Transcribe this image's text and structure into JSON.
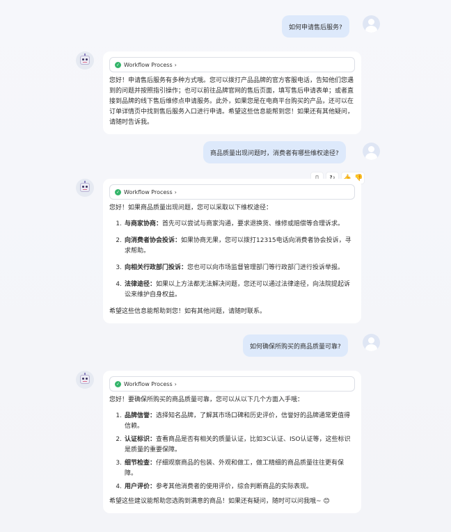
{
  "conversation": {
    "q1": "如何申请售后服务?",
    "a1": {
      "workflow": "Workflow Process",
      "text": "您好！申请售后服务有多种方式哦。您可以拨打产品品牌的官方客服电话，告知他们您遇到的问题并按照指引操作；也可以前往品牌官网的售后页面，填写售后申请表单；或者直接到品牌的线下售后维修点申请服务。此外，如果您是在电商平台购买的产品，还可以在订单详情页中找到售后服务入口进行申请。希望这些信息能帮到您！如果还有其他疑问，请随时告诉我。"
    },
    "q2": "商品质量出现问题时，消费者有哪些维权途径?",
    "a2": {
      "workflow": "Workflow Process",
      "intro": "您好！如果商品质量出现问题，您可以采取以下维权途径：",
      "items": [
        {
          "num": "1.",
          "title": "与商家协商：",
          "text": "首先可以尝试与商家沟通，要求退换货、维修或赔偿等合理诉求。"
        },
        {
          "num": "2.",
          "title": "向消费者协会投诉：",
          "text": "如果协商无果，您可以拨打12315电话向消费者协会投诉，寻求帮助。"
        },
        {
          "num": "3.",
          "title": "向相关行政部门投诉：",
          "text": "您也可以向市场监督管理部门等行政部门进行投诉举报。"
        },
        {
          "num": "4.",
          "title": "法律途径：",
          "text": "如果以上方法都无法解决问题，您还可以通过法律途径，向法院提起诉讼来维护自身权益。"
        }
      ],
      "outro": "希望这些信息能帮助到您！如有其他问题，请随时联系。"
    },
    "q3": "如何确保所购买的商品质量可靠?",
    "a3": {
      "workflow": "Workflow Process",
      "intro": "您好！要确保所购买的商品质量可靠，您可以从以下几个方面入手哦：",
      "items": [
        {
          "num": "1.",
          "title": "品牌信誉：",
          "text": "选择知名品牌，了解其市场口碑和历史评价，信誉好的品牌通常更值得信赖。"
        },
        {
          "num": "2.",
          "title": "认证标识：",
          "text": "查看商品是否有相关的质量认证，比如3C认证、ISO认证等，这些标识是质量的重要保障。"
        },
        {
          "num": "3.",
          "title": "细节检查：",
          "text": "仔细观察商品的包装、外观和做工，做工精细的商品质量往往更有保障。"
        },
        {
          "num": "4.",
          "title": "用户评价：",
          "text": "参考其他消费者的使用评价，综合判断商品的实际表现。"
        }
      ],
      "outro": "希望这些建议能帮助您选购到满意的商品！如果还有疑问，随时可以问我哦~ 😊"
    }
  },
  "toolbar_icons": [
    "clipboard-icon",
    "refresh-icon",
    "thumbs-up-icon",
    "thumbs-down-icon"
  ]
}
